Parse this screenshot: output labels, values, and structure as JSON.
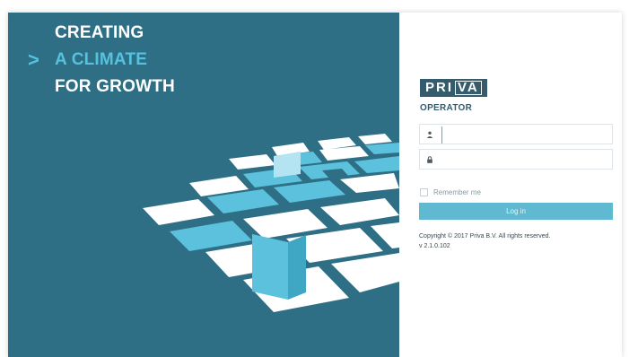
{
  "hero": {
    "arrow": ">",
    "lines": [
      "CREATING",
      "A CLIMATE",
      "FOR GROWTH"
    ]
  },
  "brand": {
    "logo_main": "PRI",
    "logo_boxed": "VA",
    "app_name": "OPERATOR"
  },
  "login": {
    "username_value": "",
    "password_value": "",
    "user_icon": "user-icon",
    "lock_icon": "lock-icon",
    "remember_label": "Remember me",
    "remember_checked": false,
    "button_label": "Log in"
  },
  "footer": {
    "copyright": "Copyright © 2017 Priva B.V. All rights reserved.",
    "version": "v 2.1.0.102"
  },
  "colors": {
    "hero_bg": "#2e6f86",
    "accent": "#56c2dd",
    "button": "#5fb9d0",
    "logo_bg": "#345c6c"
  }
}
